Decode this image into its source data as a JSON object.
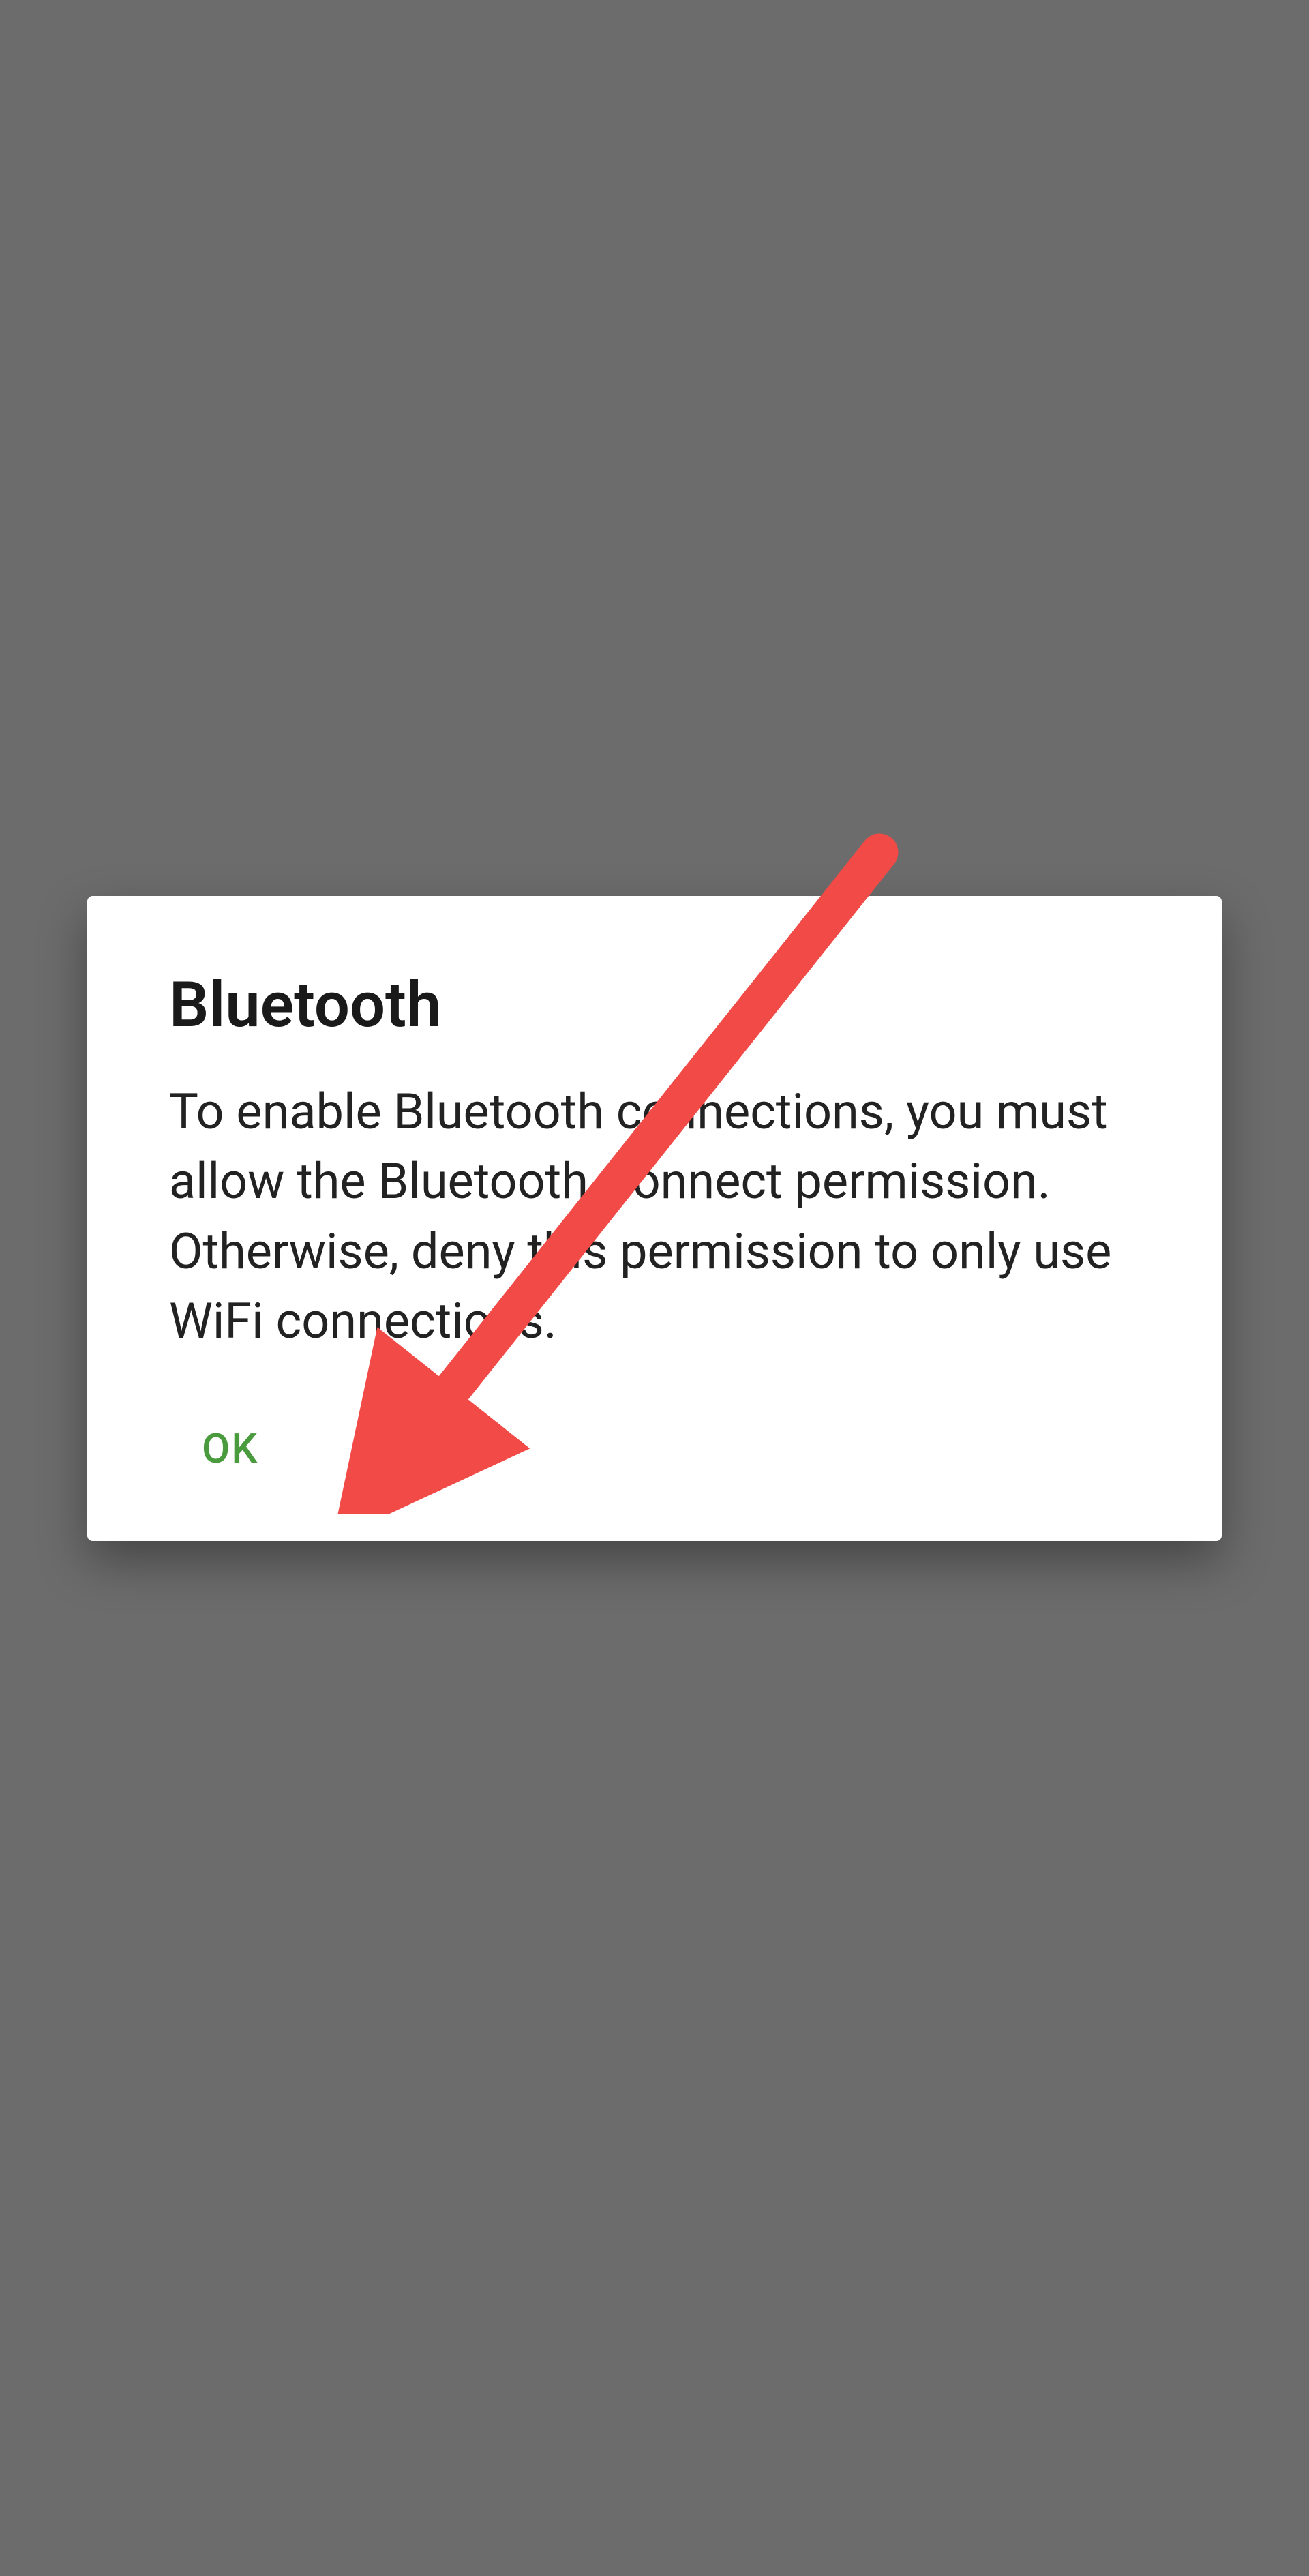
{
  "dialog": {
    "title": "Bluetooth",
    "body": "To enable Bluetooth connections, you must allow the Bluetooth Connect permission. Otherwise, deny this permission to only use WiFi connections.",
    "ok_label": "OK"
  },
  "annotation": {
    "type": "arrow",
    "color": "#f24a46"
  }
}
